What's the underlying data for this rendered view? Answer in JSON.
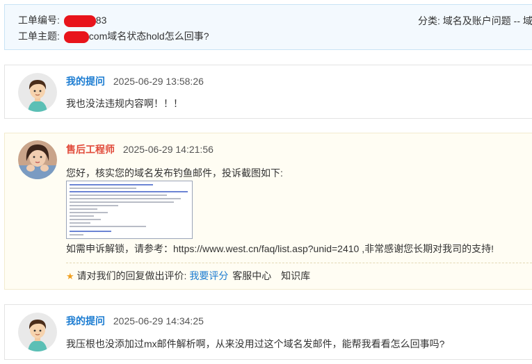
{
  "ticket": {
    "number_label": "工单编号:",
    "number_suffix": "83",
    "subject_label": "工单主题:",
    "subject_suffix": "com域名状态hold怎么回事?",
    "category": "分类:  域名及账户问题 -- 域"
  },
  "messages": [
    {
      "author": "我的提问",
      "time": "2025-06-29 13:58:26",
      "text": "我也没法违规内容啊！！！"
    },
    {
      "author": "售后工程师",
      "time": "2025-06-29 14:21:56",
      "text": "您好，核实您的域名发布钓鱼邮件，投诉截图如下:",
      "text2": "如需申诉解锁，请参考：https://www.west.cn/faq/list.asp?unid=2410 ,非常感谢您长期对我司的支持!",
      "rating_prompt": "请对我们的回复做出评价:",
      "rate_link": "我要评分",
      "service_link": "客服中心",
      "kb_link": "知识库"
    },
    {
      "author": "我的提问",
      "time": "2025-06-29 14:34:25",
      "text": "我压根也没添加过mx邮件解析啊，从来没用过这个域名发邮件，能帮我看看怎么回事吗?"
    }
  ],
  "colors": {
    "user_author": "#1a7bd1",
    "engineer_author": "#e14a3a",
    "redaction": "#e8141b"
  },
  "icons": {
    "rating": "star-icon"
  }
}
